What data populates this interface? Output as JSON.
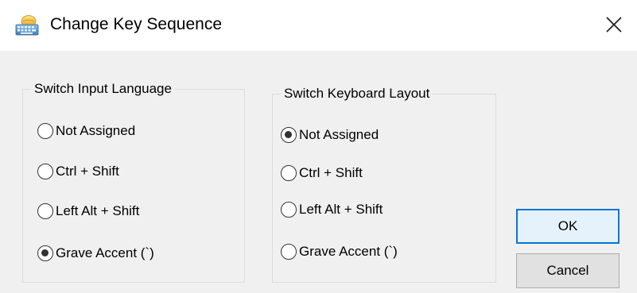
{
  "window": {
    "title": "Change Key Sequence",
    "icon": "keyboard-icon",
    "close_icon": "close-icon"
  },
  "groups": [
    {
      "legend": "Switch Input Language",
      "options": [
        {
          "label": "Not Assigned",
          "checked": false
        },
        {
          "label": "Ctrl + Shift",
          "checked": false
        },
        {
          "label": "Left Alt + Shift",
          "checked": false
        },
        {
          "label": "Grave Accent (`)",
          "checked": true
        }
      ]
    },
    {
      "legend": "Switch Keyboard Layout",
      "options": [
        {
          "label": "Not Assigned",
          "checked": true
        },
        {
          "label": "Ctrl + Shift",
          "checked": false
        },
        {
          "label": "Left Alt + Shift",
          "checked": false
        },
        {
          "label": "Grave Accent (`)",
          "checked": false
        }
      ]
    }
  ],
  "buttons": {
    "ok_label": "OK",
    "cancel_label": "Cancel"
  },
  "colors": {
    "client_bg": "#f0f0f0",
    "accent": "#0078d7",
    "ok_bg": "#e5f1fb"
  }
}
